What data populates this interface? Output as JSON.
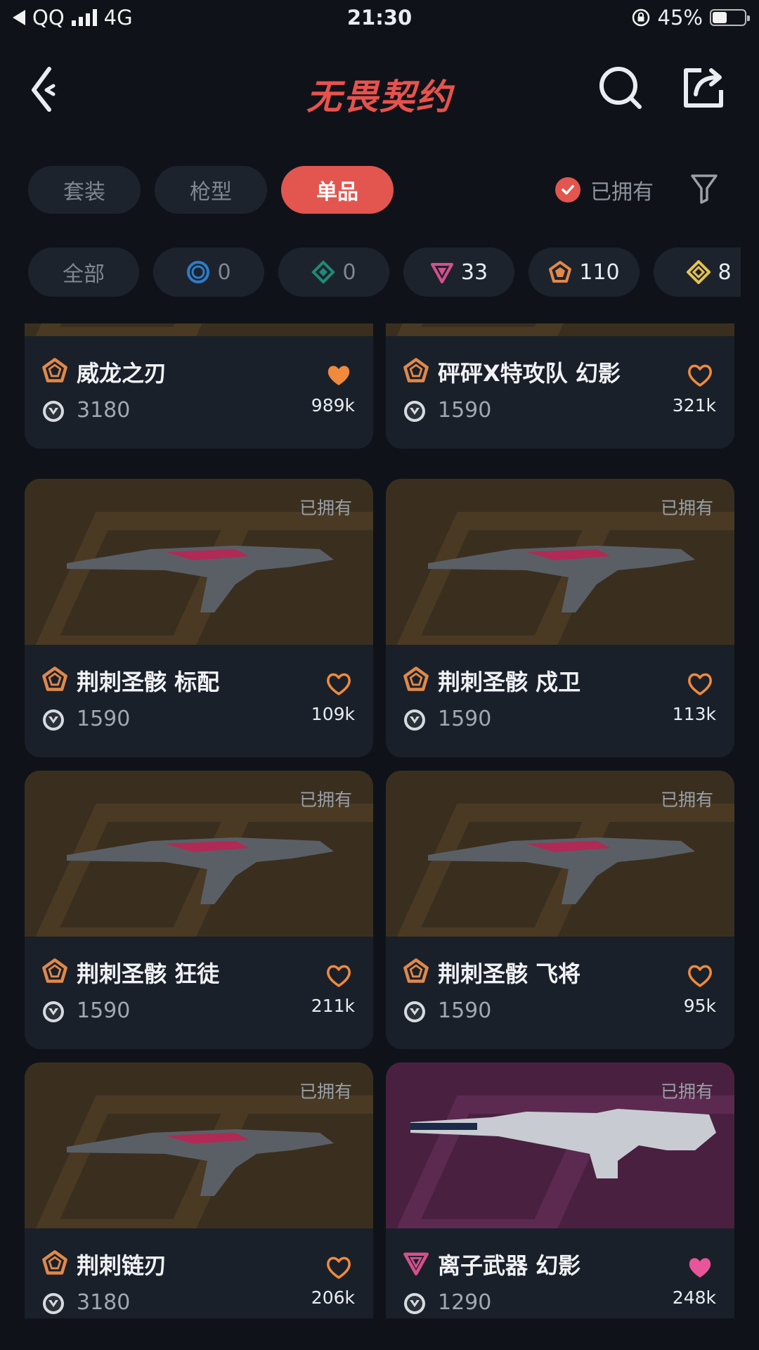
{
  "status_bar": {
    "carrier": "QQ",
    "network": "4G",
    "time": "21:30",
    "battery": "45%"
  },
  "header": {
    "title": "无畏契约"
  },
  "tabs": [
    {
      "label": "套装",
      "active": false
    },
    {
      "label": "枪型",
      "active": false
    },
    {
      "label": "单品",
      "active": true
    }
  ],
  "owned_filter": {
    "label": "已拥有",
    "checked": true
  },
  "rarity_chips": [
    {
      "label": "全部",
      "icon": ""
    },
    {
      "label": "0",
      "icon": "select-tier-icon",
      "color": "#2e7cc9"
    },
    {
      "label": "0",
      "icon": "deluxe-tier-icon",
      "color": "#1f8a78"
    },
    {
      "label": "33",
      "icon": "premium-tier-icon",
      "color": "#d4508e"
    },
    {
      "label": "110",
      "icon": "exclusive-tier-icon",
      "color": "#e0894a"
    },
    {
      "label": "8",
      "icon": "ultra-tier-icon",
      "color": "#e5c352"
    }
  ],
  "items": [
    {
      "name": "威龙之刃",
      "price": "3180",
      "likes": "989k",
      "rarity": "exclusive",
      "rarity_color": "#e0894a",
      "liked": true,
      "heart_color": "#f08a3c",
      "owned_label": ""
    },
    {
      "name": "砰砰X特攻队 幻影",
      "price": "1590",
      "likes": "321k",
      "rarity": "exclusive",
      "rarity_color": "#e0894a",
      "liked": false,
      "heart_color": "#f08a3c",
      "owned_label": ""
    },
    {
      "name": "荆刺圣骸 标配",
      "price": "1590",
      "likes": "109k",
      "rarity": "exclusive",
      "rarity_color": "#e0894a",
      "liked": false,
      "heart_color": "#f08a3c",
      "owned_label": "已拥有"
    },
    {
      "name": "荆刺圣骸 戍卫",
      "price": "1590",
      "likes": "113k",
      "rarity": "exclusive",
      "rarity_color": "#e0894a",
      "liked": false,
      "heart_color": "#f08a3c",
      "owned_label": "已拥有"
    },
    {
      "name": "荆刺圣骸 狂徒",
      "price": "1590",
      "likes": "211k",
      "rarity": "exclusive",
      "rarity_color": "#e0894a",
      "liked": false,
      "heart_color": "#f08a3c",
      "owned_label": "已拥有"
    },
    {
      "name": "荆刺圣骸 飞将",
      "price": "1590",
      "likes": "95k",
      "rarity": "exclusive",
      "rarity_color": "#e0894a",
      "liked": false,
      "heart_color": "#f08a3c",
      "owned_label": "已拥有"
    },
    {
      "name": "荆刺链刃",
      "price": "3180",
      "likes": "206k",
      "rarity": "exclusive",
      "rarity_color": "#e0894a",
      "liked": false,
      "heart_color": "#f08a3c",
      "owned_label": "已拥有"
    },
    {
      "name": "离子武器 幻影",
      "price": "1290",
      "likes": "248k",
      "rarity": "premium",
      "rarity_color": "#d4508e",
      "liked": true,
      "heart_color": "#e8559a",
      "owned_label": "已拥有"
    }
  ]
}
